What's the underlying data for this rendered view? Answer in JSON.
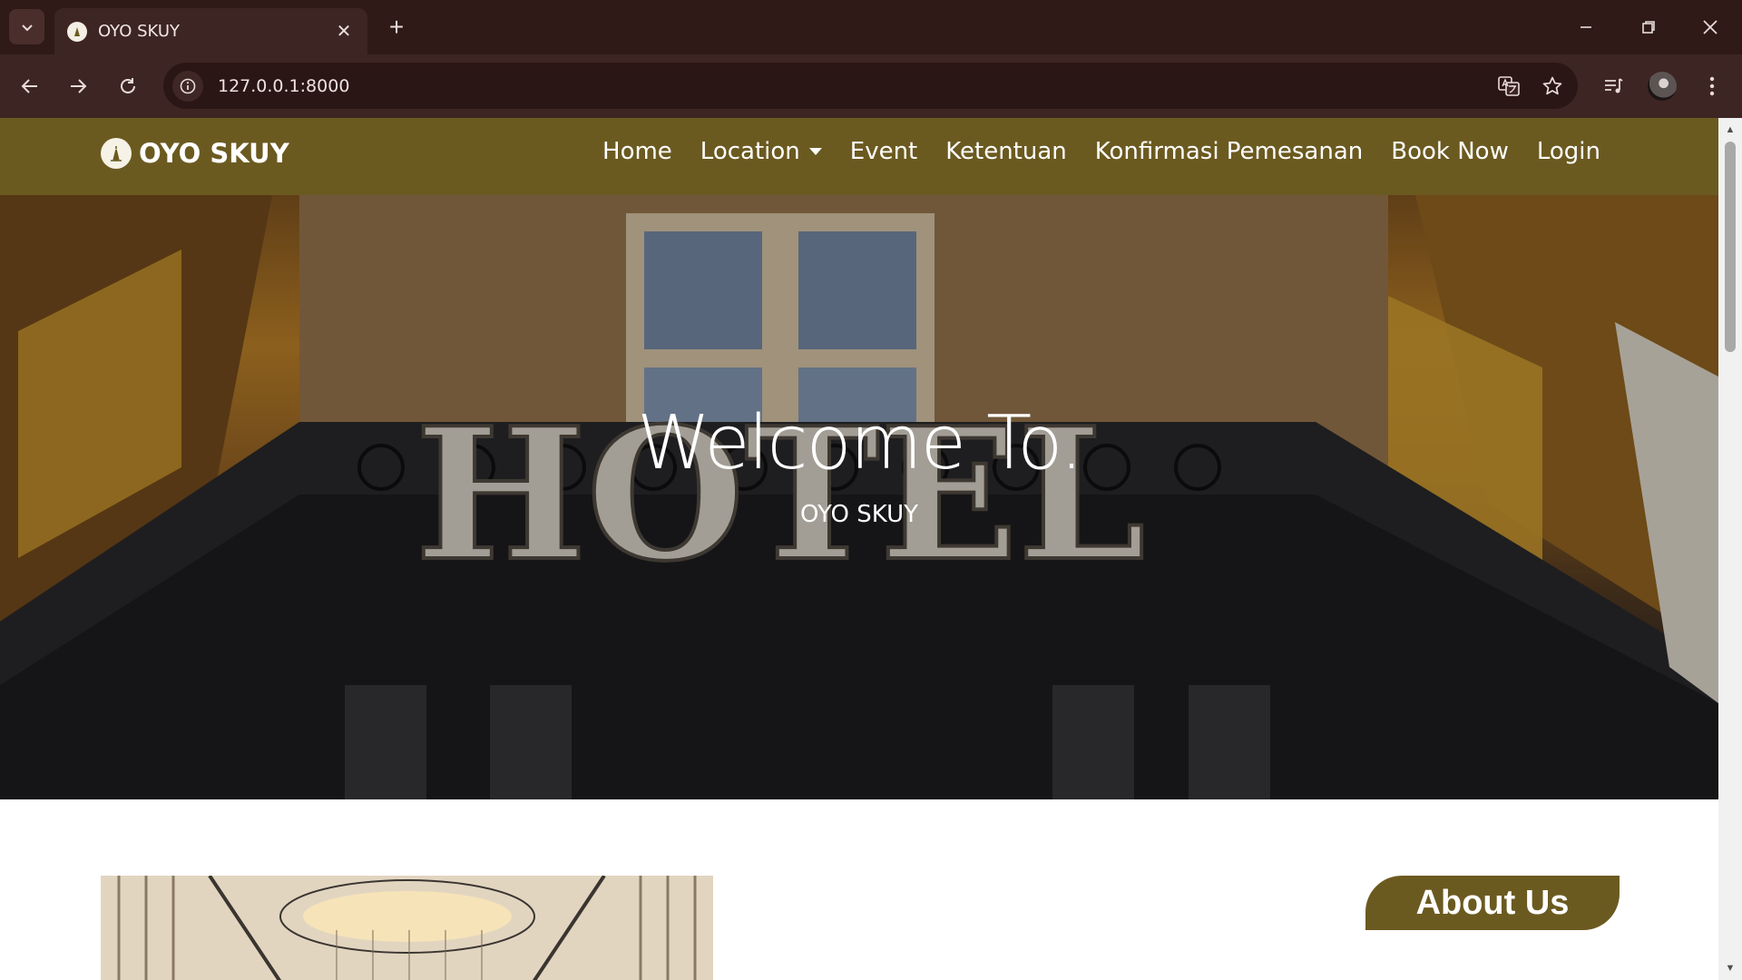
{
  "browser": {
    "tab_title": "OYO SKUY",
    "url": "127.0.0.1:8000"
  },
  "nav": {
    "brand": "OYO SKUY",
    "items": [
      {
        "label": "Home"
      },
      {
        "label": "Location"
      },
      {
        "label": "Event"
      },
      {
        "label": "Ketentuan"
      },
      {
        "label": "Konfirmasi Pemesanan"
      },
      {
        "label": "Book Now"
      },
      {
        "label": "Login"
      }
    ]
  },
  "hero": {
    "title": "Welcome To.",
    "subtitle": "OYO SKUY",
    "sign_text": "HOTEL"
  },
  "about": {
    "heading": "About Us"
  },
  "colors": {
    "brand_olive": "#6b5a20",
    "browser_dark": "#2f1a18"
  }
}
